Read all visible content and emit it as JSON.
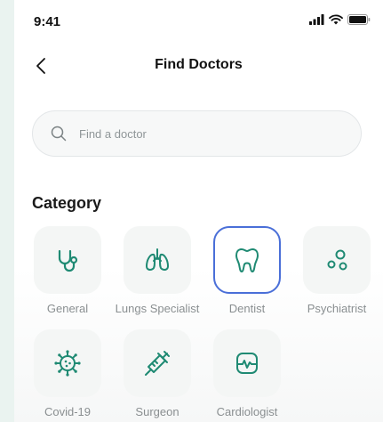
{
  "status_bar": {
    "time": "9:41"
  },
  "header": {
    "title": "Find Doctors"
  },
  "search": {
    "placeholder": "Find a doctor",
    "value": ""
  },
  "category": {
    "title": "Category",
    "selected": "Dentist",
    "items": [
      {
        "label": "General",
        "icon": "stethoscope-icon"
      },
      {
        "label": "Lungs Specialist",
        "icon": "lungs-icon"
      },
      {
        "label": "Dentist",
        "icon": "tooth-icon"
      },
      {
        "label": "Psychiatrist",
        "icon": "molecule-icon"
      },
      {
        "label": "Covid-19",
        "icon": "virus-icon"
      },
      {
        "label": "Surgeon",
        "icon": "syringe-icon"
      },
      {
        "label": "Cardiologist",
        "icon": "heart-monitor-icon"
      }
    ]
  },
  "colors": {
    "accent": "#1f8a73",
    "selected_border": "#4a6fd8",
    "background": "#eaf3f0"
  }
}
